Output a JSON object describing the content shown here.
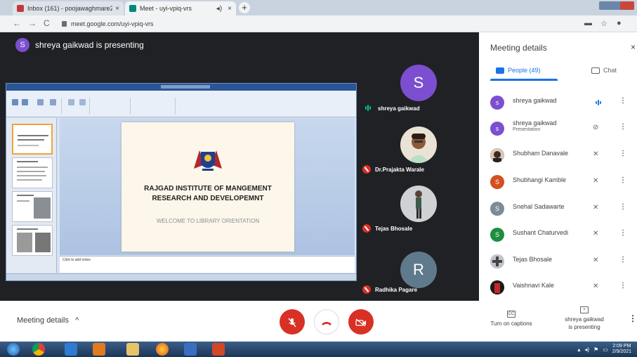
{
  "browser": {
    "tabs": [
      {
        "label": "Inbox (161) - poojawaghmare2",
        "close": "×"
      },
      {
        "label": "Meet - uyi-vpiq-vrs",
        "close": "×"
      }
    ],
    "new_tab": "+",
    "audio_icon": "◂)",
    "url": "meet.google.com/uyi-vpiq-vrs",
    "nav": {
      "back": "←",
      "forward": "→",
      "reload": "C"
    },
    "toolbar_icons": {
      "cast": "▬",
      "star": "☆",
      "profile": "●"
    }
  },
  "stage": {
    "presenter_avatar": "S",
    "presenter_text": "shreya gaikwad is presenting"
  },
  "slide": {
    "title_line1": "RAJGAD INSTITUTE OF MANGEMENT",
    "title_line2": "RESEARCH AND DEVELOPEMNT",
    "subtitle": "WELCOME TO LIBRARY ORIENTATION",
    "notes_placeholder": "Click to add notes"
  },
  "tiles": [
    {
      "name": "shreya gaikwad",
      "avatar": "S",
      "avatar_color": "#7b4fcf",
      "speaking": true
    },
    {
      "name": "Dr.Prajakta Warale",
      "muted": true
    },
    {
      "name": "Tejas Bhosale",
      "muted": true
    },
    {
      "name": "Radhika Pagare",
      "avatar": "R",
      "avatar_color": "#5f7a8c",
      "muted": true
    }
  ],
  "panel": {
    "title": "Meeting details",
    "close": "×",
    "tab_people": "People (49)",
    "tab_chat": "Chat",
    "more": "⋮",
    "participants": [
      {
        "name": "shreya gaikwad",
        "sub": "",
        "avatar": "s",
        "color": "#7b4fcf",
        "status": "speaking"
      },
      {
        "name": "shreya gaikwad",
        "sub": "Presentation",
        "avatar": "s",
        "color": "#7b4fcf",
        "status": "present"
      },
      {
        "name": "Shubham Danavale",
        "sub": "",
        "avatar": "",
        "color": "#3a2a22",
        "status": "muted"
      },
      {
        "name": "Shubhangi Kamble",
        "sub": "",
        "avatar": "S",
        "color": "#d3501f",
        "status": "muted"
      },
      {
        "name": "Snehal Sadawarte",
        "sub": "",
        "avatar": "S",
        "color": "#7a8b99",
        "status": "muted"
      },
      {
        "name": "Sushant Chaturvedi",
        "sub": "",
        "avatar": "S",
        "color": "#1e8e3e",
        "status": "muted"
      },
      {
        "name": "Tejas Bhosale",
        "sub": "",
        "avatar": "",
        "color": "#6a6a6a",
        "status": "muted"
      },
      {
        "name": "Vaishnavi Kale",
        "sub": "",
        "avatar": "",
        "color": "#b71c1c",
        "status": "muted"
      }
    ]
  },
  "bottombar": {
    "meeting_details": "Meeting details",
    "chevron": "^",
    "captions_icon": "CC",
    "captions": "Turn on captions",
    "presenting_icon": "+",
    "presenting_line1": "shreya gaikwad",
    "presenting_line2": "is presenting",
    "more": "⋮"
  },
  "taskbar": {
    "time": "2:09 PM",
    "date": "2/9/2021"
  }
}
